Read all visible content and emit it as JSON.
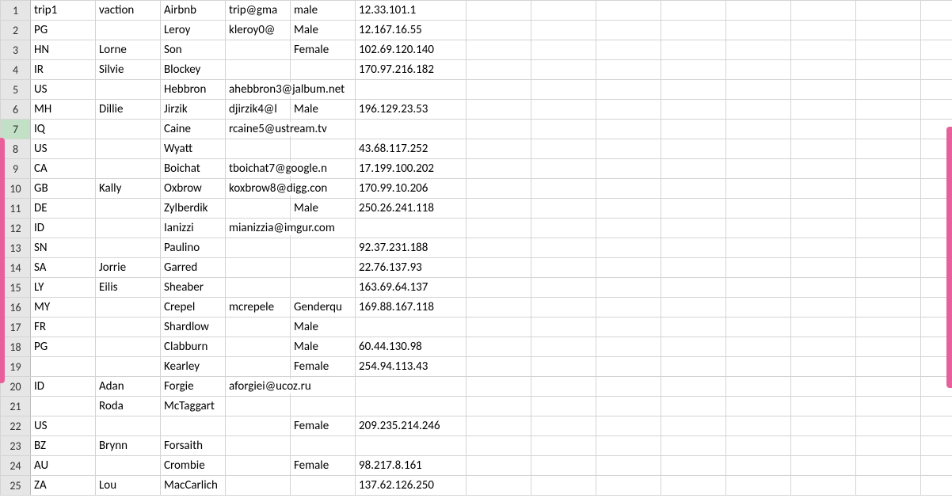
{
  "selected_row_index": 6,
  "rows": [
    {
      "n": 1,
      "a": "trip1",
      "b": "vaction",
      "c": "Airbnb",
      "d": "trip@gma",
      "e": "male",
      "f": "12.33.101.1"
    },
    {
      "n": 2,
      "a": "PG",
      "b": "",
      "c": "Leroy",
      "d": "kleroy0@",
      "e": "Male",
      "f": "12.167.16.55"
    },
    {
      "n": 3,
      "a": "HN",
      "b": "Lorne",
      "c": "Son",
      "d": "",
      "e": "Female",
      "f": "102.69.120.140"
    },
    {
      "n": 4,
      "a": "IR",
      "b": "Silvie",
      "c": "Blockey",
      "d": "",
      "e": "",
      "f": "170.97.216.182"
    },
    {
      "n": 5,
      "a": "US",
      "b": "",
      "c": "Hebbron",
      "d": "ahebbron3@jalbum.net",
      "d_spill": true,
      "e": "",
      "f": ""
    },
    {
      "n": 6,
      "a": "MH",
      "b": "Dillie",
      "c": "Jirzik",
      "d": "djirzik4@l",
      "e": "Male",
      "f": "196.129.23.53"
    },
    {
      "n": 7,
      "a": "IQ",
      "b": "",
      "c": "Caine",
      "d": "rcaine5@ustream.tv",
      "d_spill": true,
      "e": "",
      "f": ""
    },
    {
      "n": 8,
      "a": "US",
      "b": "",
      "c": "Wyatt",
      "d": "",
      "e": "",
      "f": "43.68.117.252"
    },
    {
      "n": 9,
      "a": "CA",
      "b": "",
      "c": "Boichat",
      "d": "tboichat7@google.n",
      "d_spill": true,
      "e": "",
      "f": "17.199.100.202"
    },
    {
      "n": 10,
      "a": "GB",
      "b": "Kally",
      "c": "Oxbrow",
      "d": "koxbrow8@digg.con",
      "d_spill": true,
      "e": "",
      "f": "170.99.10.206"
    },
    {
      "n": 11,
      "a": "DE",
      "b": "",
      "c": "Zylberdik",
      "d": "",
      "e": "Male",
      "f": "250.26.241.118"
    },
    {
      "n": 12,
      "a": "ID",
      "b": "",
      "c": "Ianizzi",
      "d": "mianizzia@imgur.com",
      "d_spill": true,
      "e": "",
      "f": ""
    },
    {
      "n": 13,
      "a": "SN",
      "b": "",
      "c": "Paulino",
      "d": "",
      "e": "",
      "f": "92.37.231.188"
    },
    {
      "n": 14,
      "a": "SA",
      "b": "Jorrie",
      "c": "Garred",
      "d": "",
      "e": "",
      "f": "22.76.137.93"
    },
    {
      "n": 15,
      "a": "LY",
      "b": "Eilis",
      "c": "Sheaber",
      "d": "",
      "e": "",
      "f": "163.69.64.137"
    },
    {
      "n": 16,
      "a": "MY",
      "b": "",
      "c": "Crepel",
      "d": "mcrepele",
      "e": "Genderqu",
      "f": "169.88.167.118"
    },
    {
      "n": 17,
      "a": "FR",
      "b": "",
      "c": "Shardlow",
      "d": "",
      "e": "Male",
      "f": ""
    },
    {
      "n": 18,
      "a": "PG",
      "b": "",
      "c": "Clabburn",
      "d": "",
      "e": "Male",
      "f": "60.44.130.98"
    },
    {
      "n": 19,
      "a": "",
      "b": "",
      "c": "Kearley",
      "d": "",
      "e": "Female",
      "f": "254.94.113.43"
    },
    {
      "n": 20,
      "a": "ID",
      "b": "Adan",
      "c": "Forgie",
      "d": "aforgiei@ucoz.ru",
      "d_spill": true,
      "e": "",
      "f": ""
    },
    {
      "n": 21,
      "a": "",
      "b": "Roda",
      "c": "McTaggart",
      "d": "",
      "e": "",
      "f": ""
    },
    {
      "n": 22,
      "a": "US",
      "b": "",
      "c": "",
      "d": "",
      "e": "Female",
      "f": "209.235.214.246"
    },
    {
      "n": 23,
      "a": "BZ",
      "b": "Brynn",
      "c": "Forsaith",
      "d": "",
      "e": "",
      "f": ""
    },
    {
      "n": 24,
      "a": "AU",
      "b": "",
      "c": "Crombie",
      "d": "",
      "e": "Female",
      "f": "98.217.8.161"
    },
    {
      "n": 25,
      "a": "ZA",
      "b": "Lou",
      "c": "MacCarlich",
      "d": "",
      "e": "",
      "f": "137.62.126.250"
    }
  ],
  "extra_blank_cols": 8
}
